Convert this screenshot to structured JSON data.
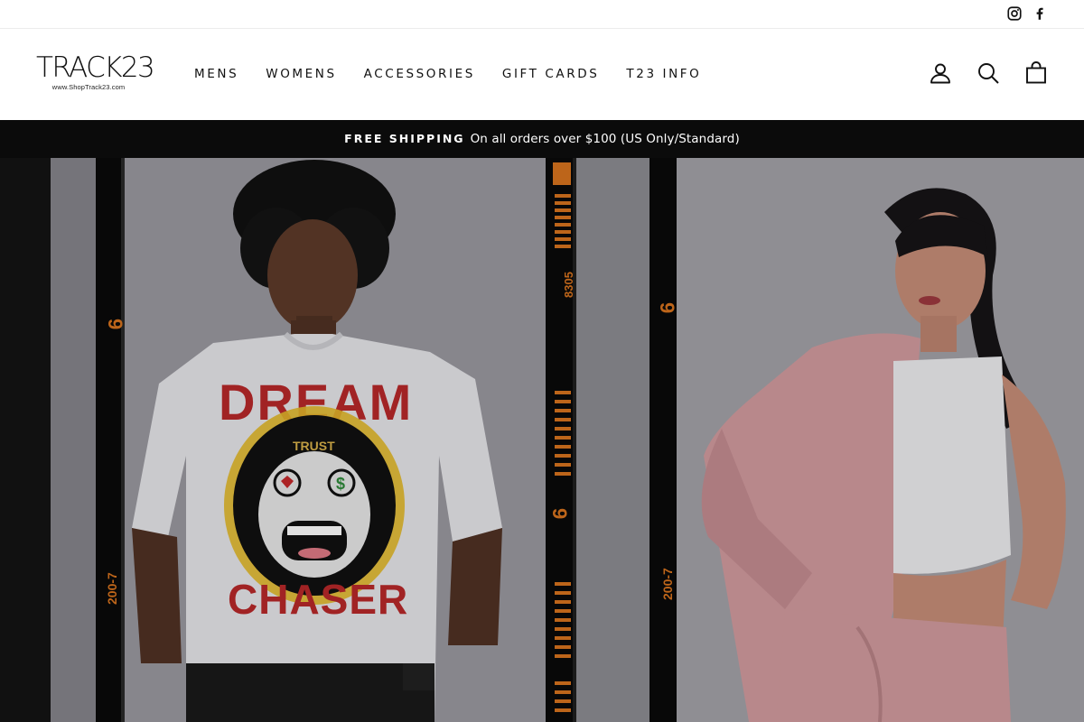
{
  "social": {
    "instagram": "instagram-icon",
    "facebook": "facebook-icon"
  },
  "brand": {
    "name": "TRACK23",
    "url": "www.ShopTrack23.com"
  },
  "nav": {
    "items": [
      {
        "label": "MENS"
      },
      {
        "label": "WOMENS"
      },
      {
        "label": "ACCESSORIES"
      },
      {
        "label": "GIFT CARDS"
      },
      {
        "label": "T23 INFO"
      }
    ]
  },
  "header_icons": {
    "account": "user-icon",
    "search": "search-icon",
    "cart": "bag-icon"
  },
  "announcement": {
    "bold": "FREE SHIPPING",
    "text": "On all orders over $100 (US Only/Standard)"
  },
  "hero": {
    "left": {
      "shirt_text_top": "DREAM",
      "shirt_text_bottom": "CHASER",
      "shirt_badge": "TRUST",
      "film_marks": [
        "9",
        "8305",
        "9",
        "200-7"
      ]
    },
    "right": {
      "film_marks": [
        "9",
        "200-7"
      ]
    }
  },
  "colors": {
    "announcement_bg": "#0b0b0b",
    "film_orange": "#d8731e",
    "hoodie_pink": "#d29b9f"
  }
}
